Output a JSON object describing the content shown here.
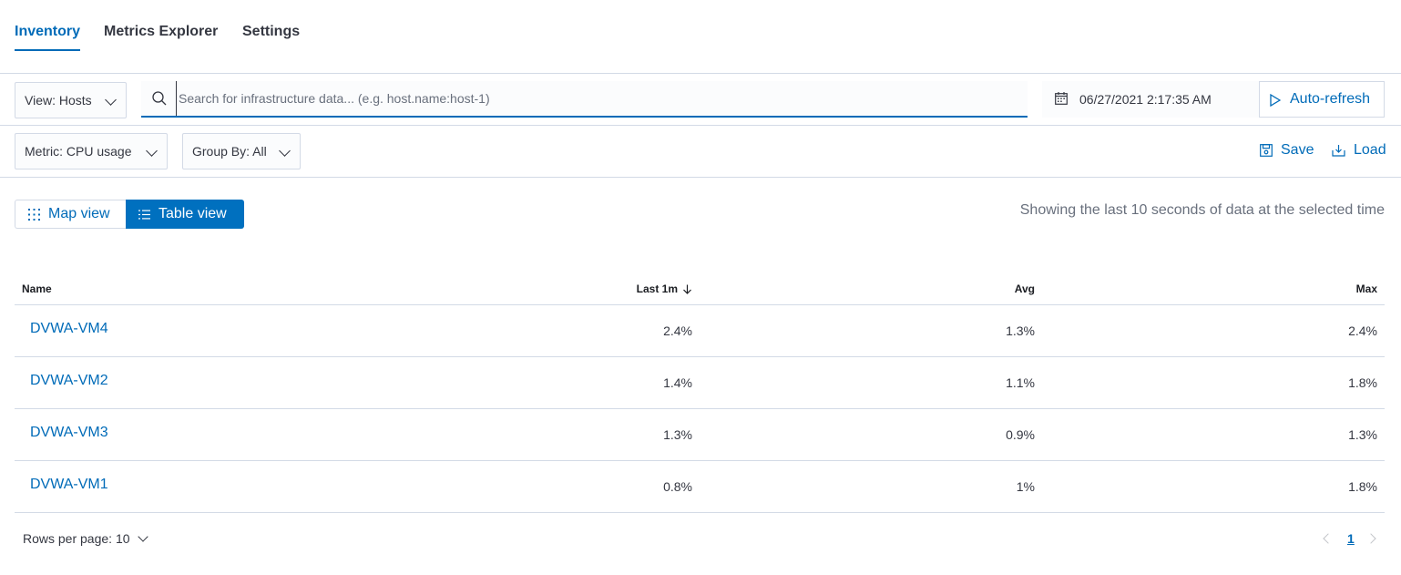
{
  "tabs": [
    {
      "label": "Inventory",
      "active": true
    },
    {
      "label": "Metrics Explorer",
      "active": false
    },
    {
      "label": "Settings",
      "active": false
    }
  ],
  "filterbar": {
    "view_select": "View: Hosts",
    "search_placeholder": "Search for infrastructure data... (e.g. host.name:host-1)",
    "search_value": "",
    "date": "06/27/2021 2:17:35 AM",
    "auto_refresh_label": "Auto-refresh"
  },
  "toolbar": {
    "metric_select": "Metric: CPU usage",
    "group_select": "Group By: All",
    "save_label": "Save",
    "load_label": "Load"
  },
  "view_toggle": {
    "map_label": "Map view",
    "table_label": "Table view",
    "selected": "table"
  },
  "status_text": "Showing the last 10 seconds of data at the selected time",
  "table": {
    "headers": {
      "name": "Name",
      "last": "Last 1m",
      "avg": "Avg",
      "max": "Max"
    },
    "sort": {
      "column": "last",
      "direction": "desc"
    },
    "rows": [
      {
        "name": "DVWA-VM4",
        "last": "2.4%",
        "avg": "1.3%",
        "max": "2.4%"
      },
      {
        "name": "DVWA-VM2",
        "last": "1.4%",
        "avg": "1.1%",
        "max": "1.8%"
      },
      {
        "name": "DVWA-VM3",
        "last": "1.3%",
        "avg": "0.9%",
        "max": "1.3%"
      },
      {
        "name": "DVWA-VM1",
        "last": "0.8%",
        "avg": "1%",
        "max": "1.8%"
      }
    ]
  },
  "pagination": {
    "rows_per_page": "Rows per page: 10",
    "current_page": "1"
  },
  "colors": {
    "accent": "#006bb8",
    "primary_fill": "#0070bf",
    "border": "#d3dae6",
    "subdued_text": "#69707d"
  }
}
